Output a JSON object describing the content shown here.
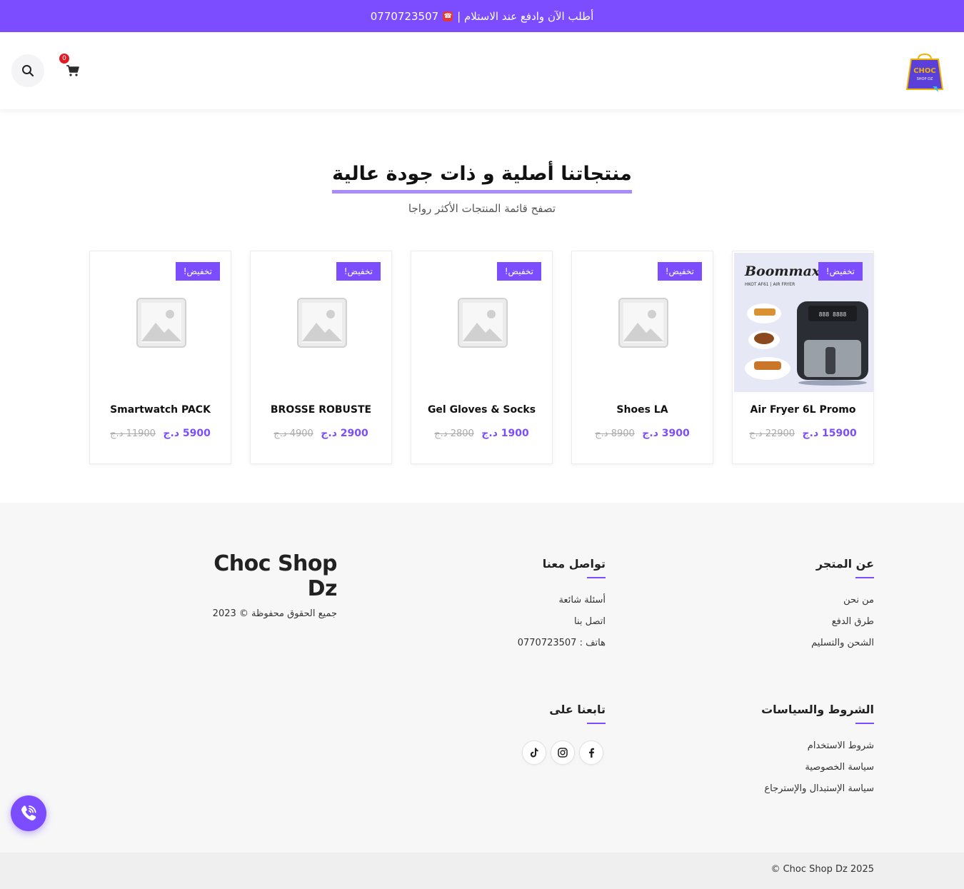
{
  "topbar": {
    "text_main": "أطلب الآن وادفع عند الاستلام |",
    "phone": "0770723507"
  },
  "header": {
    "logo": {
      "line1": "CHOC",
      "line2": "SHOP DZ"
    },
    "cart_count": "0"
  },
  "section": {
    "title": "منتجاتنا أصلية و ذات جودة عالية",
    "subtitle": "تصفح قائمة المنتجات الأكثر رواجا"
  },
  "products": [
    {
      "name": "Air Fryer 6L Promo",
      "price": "15900 د.ج",
      "old_price": "22900 د.ج",
      "badge": "تخفيض!",
      "image_brand": "Boommax",
      "image_model": "HKOT AF61 | AIR FRYER"
    },
    {
      "name": "Shoes LA",
      "price": "3900 د.ج",
      "old_price": "8900 د.ج",
      "badge": "تخفيض!"
    },
    {
      "name": "Gel Gloves & Socks",
      "price": "1900 د.ج",
      "old_price": "2800 د.ج",
      "badge": "تخفيض!"
    },
    {
      "name": "BROSSE ROBUSTE",
      "price": "2900 د.ج",
      "old_price": "4900 د.ج",
      "badge": "تخفيض!"
    },
    {
      "name": "Smartwatch PACK",
      "price": "5900 د.ج",
      "old_price": "11900 د.ج",
      "badge": "تخفيض!"
    }
  ],
  "footer": {
    "about": {
      "title": "عن المتجر",
      "links": [
        "من نحن",
        "طرق الدفع",
        "الشحن والتسليم"
      ]
    },
    "contact": {
      "title": "تواصل معنا",
      "links": [
        "أسئلة شائعة",
        "اتصل بنا",
        "هاتف : 0770723507"
      ]
    },
    "policies": {
      "title": "الشروط والسياسات",
      "links": [
        "شروط الاستخدام",
        "سياسة الخصوصية",
        "سياسة الإستبدال والإسترجاع"
      ]
    },
    "follow": {
      "title": "تابعنا على"
    },
    "brand": {
      "name": "Choc Shop Dz",
      "copyright": "جميع الحقوق محفوظة © 2023"
    }
  },
  "bottom": {
    "copyright": "© Choc Shop Dz 2025"
  },
  "colors": {
    "accent": "#7b4dff",
    "badge_red": "#e01b24"
  }
}
